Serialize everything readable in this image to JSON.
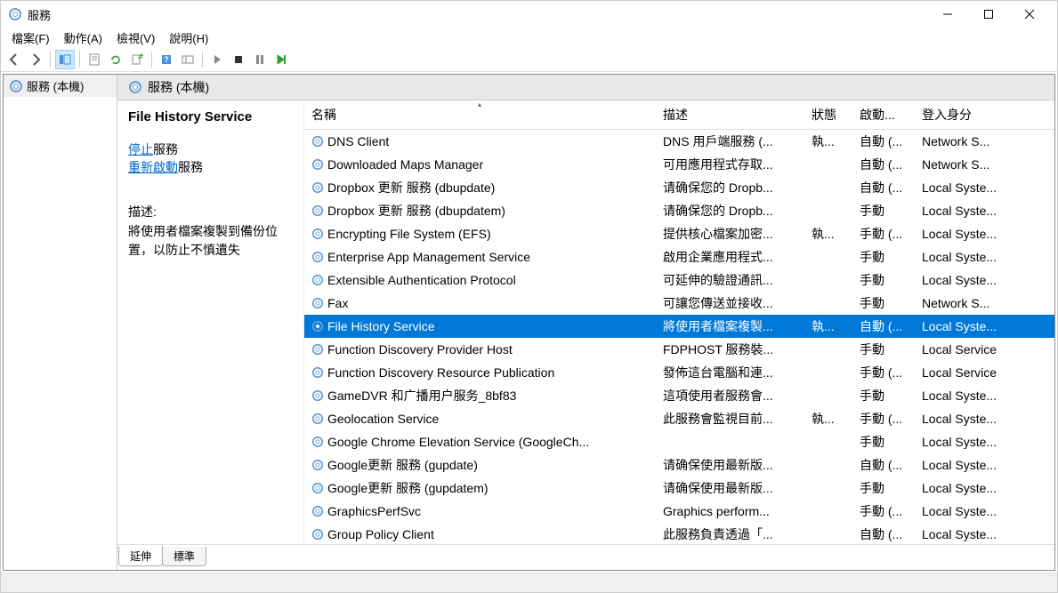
{
  "title": "服務",
  "menubar": [
    "檔案(F)",
    "動作(A)",
    "檢視(V)",
    "說明(H)"
  ],
  "tree": {
    "root": "服務 (本機)"
  },
  "panel_header": "服務 (本機)",
  "detail": {
    "title": "File History Service",
    "stop_label": "停止",
    "stop_suffix": "服務",
    "restart_label": "重新啟動",
    "restart_suffix": "服務",
    "desc_label": "描述:",
    "desc": "將使用者檔案複製到備份位置，以防止不慎遺失"
  },
  "columns": {
    "name": "名稱",
    "description": "描述",
    "status": "狀態",
    "startup": "啟動...",
    "logon": "登入身分"
  },
  "rows": [
    {
      "name": "DNS Client",
      "desc": "DNS 用戶端服務 (...",
      "status": "執...",
      "startup": "自動 (...",
      "logon": "Network S..."
    },
    {
      "name": "Downloaded Maps Manager",
      "desc": "可用應用程式存取...",
      "status": "",
      "startup": "自動 (...",
      "logon": "Network S..."
    },
    {
      "name": "Dropbox 更新 服務 (dbupdate)",
      "desc": "请确保您的 Dropb...",
      "status": "",
      "startup": "自動 (...",
      "logon": "Local Syste..."
    },
    {
      "name": "Dropbox 更新 服務 (dbupdatem)",
      "desc": "请确保您的 Dropb...",
      "status": "",
      "startup": "手動",
      "logon": "Local Syste..."
    },
    {
      "name": "Encrypting File System (EFS)",
      "desc": "提供核心檔案加密...",
      "status": "執...",
      "startup": "手動 (...",
      "logon": "Local Syste..."
    },
    {
      "name": "Enterprise App Management Service",
      "desc": "啟用企業應用程式...",
      "status": "",
      "startup": "手動",
      "logon": "Local Syste..."
    },
    {
      "name": "Extensible Authentication Protocol",
      "desc": "可延伸的驗證通訊...",
      "status": "",
      "startup": "手動",
      "logon": "Local Syste..."
    },
    {
      "name": "Fax",
      "desc": "可讓您傳送並接收...",
      "status": "",
      "startup": "手動",
      "logon": "Network S..."
    },
    {
      "name": "File History Service",
      "desc": "將使用者檔案複製...",
      "status": "執...",
      "startup": "自動 (...",
      "logon": "Local Syste...",
      "selected": true
    },
    {
      "name": "Function Discovery Provider Host",
      "desc": "FDPHOST 服務裝...",
      "status": "",
      "startup": "手動",
      "logon": "Local Service"
    },
    {
      "name": "Function Discovery Resource Publication",
      "desc": "發佈這台電腦和連...",
      "status": "",
      "startup": "手動 (...",
      "logon": "Local Service"
    },
    {
      "name": "GameDVR 和广播用户服务_8bf83",
      "desc": "這項使用者服務會...",
      "status": "",
      "startup": "手動",
      "logon": "Local Syste..."
    },
    {
      "name": "Geolocation Service",
      "desc": "此服務會監視目前...",
      "status": "執...",
      "startup": "手動 (...",
      "logon": "Local Syste..."
    },
    {
      "name": "Google Chrome Elevation Service (GoogleCh...",
      "desc": "",
      "status": "",
      "startup": "手動",
      "logon": "Local Syste..."
    },
    {
      "name": "Google更新 服務 (gupdate)",
      "desc": "请确保使用最新版...",
      "status": "",
      "startup": "自動 (...",
      "logon": "Local Syste..."
    },
    {
      "name": "Google更新 服務 (gupdatem)",
      "desc": "请确保使用最新版...",
      "status": "",
      "startup": "手動",
      "logon": "Local Syste..."
    },
    {
      "name": "GraphicsPerfSvc",
      "desc": "Graphics perform...",
      "status": "",
      "startup": "手動 (...",
      "logon": "Local Syste..."
    },
    {
      "name": "Group Policy Client",
      "desc": "此服務負責透過「...",
      "status": "",
      "startup": "自動 (...",
      "logon": "Local Syste..."
    }
  ],
  "tabs": {
    "extended": "延伸",
    "standard": "標準"
  }
}
